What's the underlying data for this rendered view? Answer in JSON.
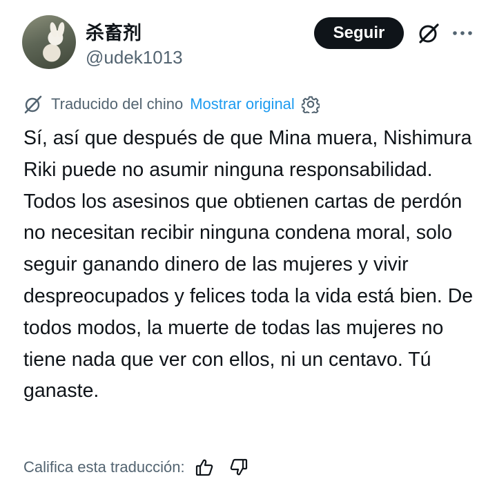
{
  "author": {
    "display_name": "杀畜剂",
    "handle": "@udek1013",
    "avatar": "rabbit-avatar"
  },
  "actions": {
    "follow_label": "Seguir",
    "grok_icon": "grok-icon",
    "more_icon": "more-icon"
  },
  "translation": {
    "translated_label": "Traducido del chino",
    "show_original_label": "Mostrar original",
    "settings_icon": "gear-icon"
  },
  "tweet": {
    "text": "Sí, así que después de que Mina muera, Nishimura Riki puede no asumir ninguna responsabilidad. Todos los asesinos que obtienen cartas de perdón no necesitan recibir ninguna condena moral, solo seguir ganando dinero de las mujeres y vivir despreocupados y felices toda la vida está bien. De todos modos, la muerte de todas las mujeres no tiene nada que ver con ellos, ni un centavo. Tú ganaste."
  },
  "rating": {
    "label": "Califica esta traducción:",
    "thumbs_up_icon": "thumbs-up-icon",
    "thumbs_down_icon": "thumbs-down-icon"
  },
  "colors": {
    "text": "#0f1419",
    "secondary": "#536471",
    "link": "#1d9bf0",
    "button_bg": "#0f1419",
    "button_text": "#ffffff"
  }
}
